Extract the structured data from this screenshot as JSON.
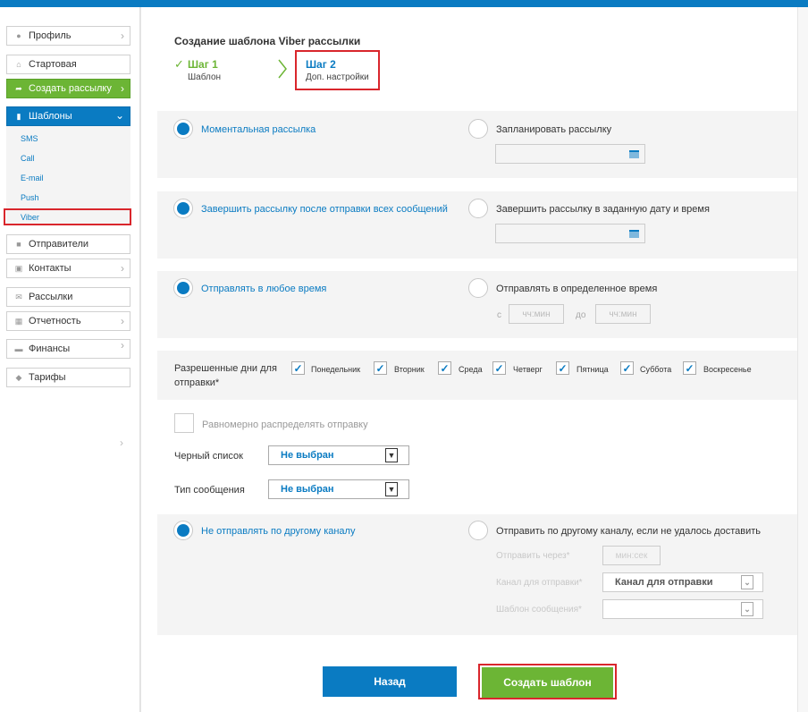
{
  "sidebar": {
    "items": [
      {
        "label": "Профиль",
        "icon": "user-icon"
      },
      {
        "label": "Стартовая",
        "icon": "home-icon"
      },
      {
        "label": "Создать рассылку",
        "icon": "share-icon"
      },
      {
        "label": "Шаблоны",
        "icon": "document-icon"
      },
      {
        "label": "Отправители",
        "icon": "message-icon"
      },
      {
        "label": "Контакты",
        "icon": "contacts-icon"
      },
      {
        "label": "Рассылки",
        "icon": "mail-icon"
      },
      {
        "label": "Отчетность",
        "icon": "report-icon"
      },
      {
        "label": "Финансы",
        "icon": "finance-icon"
      },
      {
        "label": "Тарифы",
        "icon": "tag-icon"
      }
    ],
    "submenu": [
      "SMS",
      "Call",
      "E-mail",
      "Push",
      "Viber"
    ]
  },
  "header": {
    "title": "Создание шаблона Viber рассылки",
    "step1": {
      "title": "Шаг 1",
      "subtitle": "Шаблон"
    },
    "step2": {
      "title": "Шаг 2",
      "subtitle": "Доп. настройки"
    }
  },
  "send_time": {
    "instant": "Моментальная рассылка",
    "scheduled": "Запланировать рассылку"
  },
  "finish": {
    "after_all": "Завершить рассылку после отправки всех сообщений",
    "at_date": "Завершить рассылку в заданную дату и время"
  },
  "window": {
    "any_time": "Отправлять в любое время",
    "specific_time": "Отправлять в определенное время",
    "from": "с",
    "to": "до",
    "time_placeholder": "чч:мин"
  },
  "days": {
    "label": "Разрешенные дни для отправки*",
    "list": [
      "Понедельник",
      "Вторник",
      "Среда",
      "Четверг",
      "Пятница",
      "Суббота",
      "Воскресенье"
    ]
  },
  "distribute": "Равномерно распределять отправку",
  "blacklist": {
    "label": "Черный список",
    "value": "Не выбран"
  },
  "message_type": {
    "label": "Тип сообщения",
    "value": "Не выбран"
  },
  "fallback": {
    "none": "Не отправлять по другому каналу",
    "other": "Отправить по другому каналу, если не удалось доставить",
    "send_via_label": "Отправить через*",
    "send_via_placeholder": "мин:сек",
    "channel_label": "Канал для отправки*",
    "channel_value": "Канал для отправки",
    "template_label": "Шаблон сообщения*"
  },
  "buttons": {
    "back": "Назад",
    "create": "Создать шаблон"
  },
  "colors": {
    "accent": "#0a7bc2",
    "green": "#6cb535",
    "highlight": "#d9262c"
  }
}
